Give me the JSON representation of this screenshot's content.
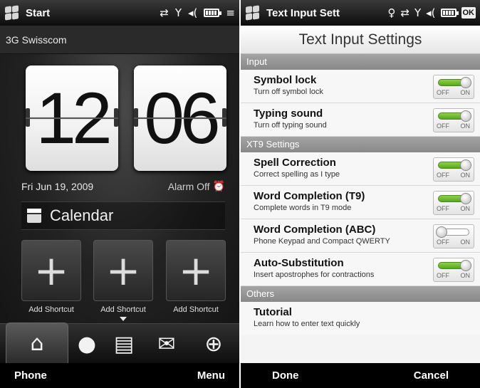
{
  "left_screen": {
    "status_bar": {
      "title": "Start",
      "icons": [
        "sync-icon",
        "signal-icon",
        "volume-icon",
        "battery-icon",
        "connectivity-icon"
      ]
    },
    "carrier": "3G Swisscom",
    "clock": {
      "hour": "12",
      "minute": "06"
    },
    "date": "Fri Jun 19, 2009",
    "alarm": "Alarm Off",
    "calendar_label": "Calendar",
    "shortcuts": [
      {
        "label": "Add Shortcut"
      },
      {
        "label": "Add Shortcut"
      },
      {
        "label": "Add Shortcut"
      }
    ],
    "tabs": [
      "home-icon",
      "people-icon",
      "messages-icon",
      "mail-icon",
      "internet-icon"
    ],
    "softkeys": {
      "left": "Phone",
      "right": "Menu"
    }
  },
  "right_screen": {
    "status_bar": {
      "title": "Text Input Sett",
      "ok_label": "OK"
    },
    "title": "Text Input Settings",
    "sections": [
      {
        "header": "Input",
        "items": [
          {
            "title": "Symbol lock",
            "subtitle": "Turn off symbol lock",
            "state": "on"
          },
          {
            "title": "Typing sound",
            "subtitle": "Turn off typing sound",
            "state": "on"
          }
        ]
      },
      {
        "header": "XT9 Settings",
        "items": [
          {
            "title": "Spell Correction",
            "subtitle": "Correct spelling as I type",
            "state": "on"
          },
          {
            "title": "Word Completion (T9)",
            "subtitle": "Complete words in T9 mode",
            "state": "on"
          },
          {
            "title": "Word Completion (ABC)",
            "subtitle": "Phone Keypad and Compact QWERTY",
            "state": "off"
          },
          {
            "title": "Auto-Substitution",
            "subtitle": "Insert apostrophes for contractions",
            "state": "on"
          }
        ]
      },
      {
        "header": "Others",
        "items": [
          {
            "title": "Tutorial",
            "subtitle": "Learn how to enter text quickly"
          }
        ]
      }
    ],
    "toggle_labels": {
      "off": "OFF",
      "on": "ON"
    },
    "softkeys": {
      "left": "Done",
      "right": "Cancel"
    }
  }
}
